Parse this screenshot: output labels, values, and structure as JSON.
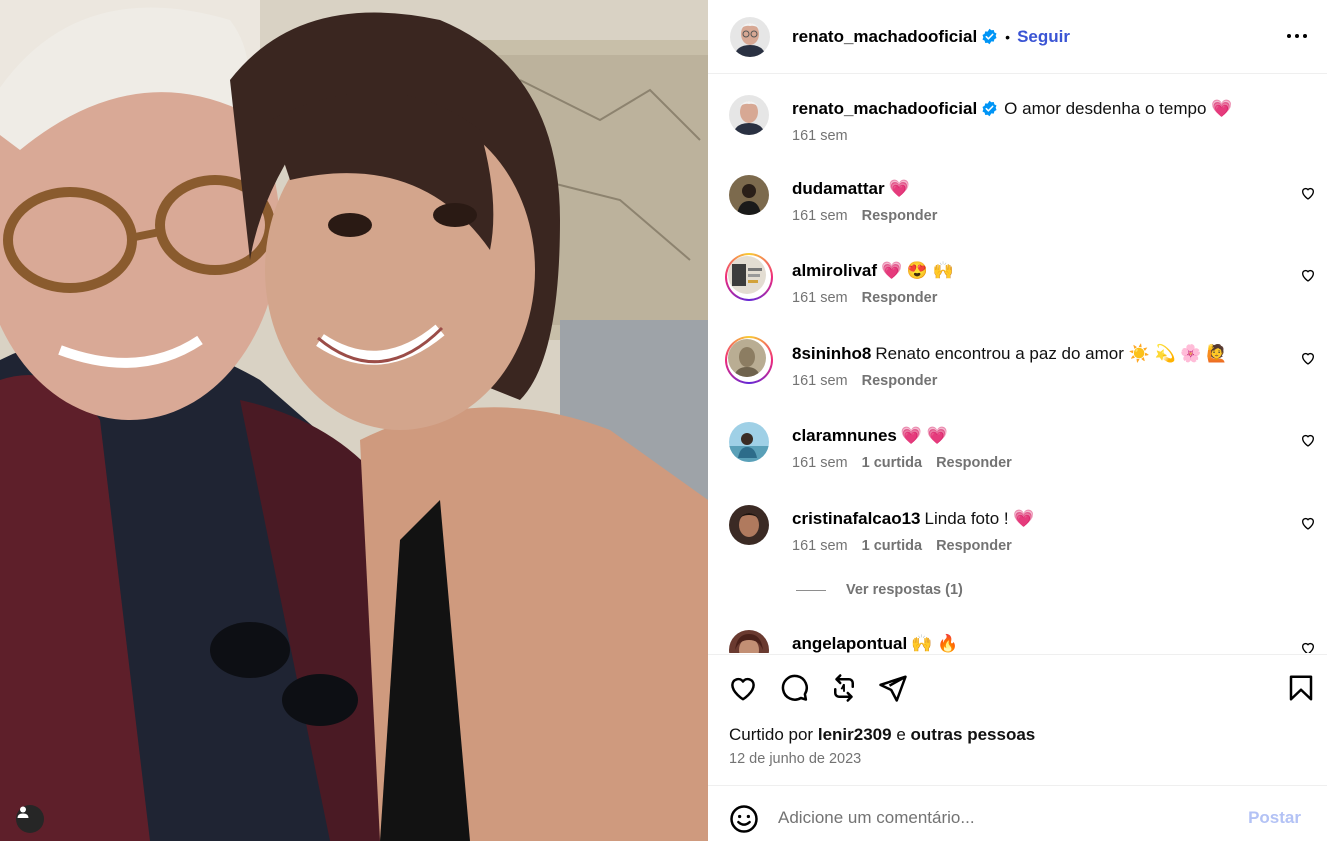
{
  "post": {
    "author": "renato_machadooficial",
    "follow_label": "Seguir",
    "separator": "•",
    "caption": "O amor desdenha o tempo 💗",
    "caption_time": "161 sem",
    "likes_prefix": "Curtido por",
    "likes_user": "lenir2309",
    "likes_conj": "e",
    "likes_others": "outras pessoas",
    "date": "12 de junho de 2023",
    "verified_color": "#0095f6",
    "accent_color": "#3a54d4"
  },
  "comments": [
    {
      "user": "dudamattar",
      "text": "💗",
      "time": "161 sem",
      "likes": "",
      "reply": "Responder",
      "story_ring": false
    },
    {
      "user": "almirolivaf",
      "text": "💗 😍 🙌",
      "time": "161 sem",
      "likes": "",
      "reply": "Responder",
      "story_ring": true
    },
    {
      "user": "8sininho8",
      "text": "Renato encontrou a paz do amor ☀️ 💫 🌸 🙋",
      "time": "161 sem",
      "likes": "",
      "reply": "Responder",
      "story_ring": true
    },
    {
      "user": "claramnunes",
      "text": "💗 💗",
      "time": "161 sem",
      "likes": "1 curtida",
      "reply": "Responder",
      "story_ring": false
    },
    {
      "user": "cristinafalcao13",
      "text": "Linda foto ! 💗",
      "time": "161 sem",
      "likes": "1 curtida",
      "reply": "Responder",
      "story_ring": false
    },
    {
      "user": "angelapontual",
      "text": "🙌 🔥",
      "time": "",
      "likes": "",
      "reply": "",
      "story_ring": false
    }
  ],
  "replies_label": "Ver respostas (1)",
  "add_comment": {
    "placeholder": "Adicione um comentário...",
    "post_label": "Postar"
  },
  "icons": {
    "more": "more-horizontal-icon",
    "like": "heart-icon",
    "comment": "comment-icon",
    "repost": "repost-icon",
    "share": "paper-plane-icon",
    "save": "bookmark-icon",
    "emoji": "emoji-icon",
    "tag": "user-tag-icon"
  }
}
